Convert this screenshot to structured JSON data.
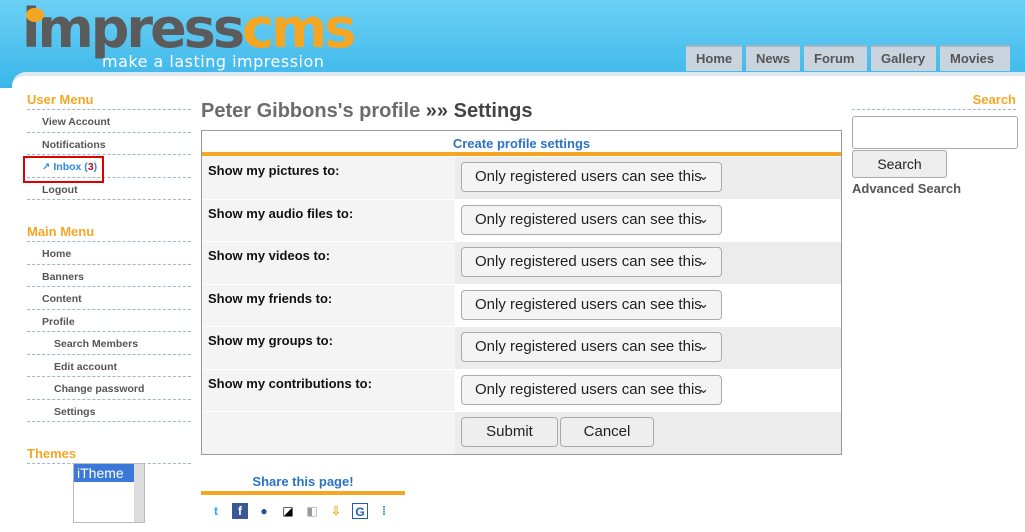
{
  "logo": {
    "part1": "impress",
    "part2": "cms",
    "tagline": "make a lasting impression"
  },
  "topnav": [
    "Home",
    "News",
    "Forum",
    "Gallery",
    "Movies"
  ],
  "user_menu": {
    "title": "User Menu",
    "items": [
      "View Account",
      "Notifications"
    ],
    "inbox_label": "Inbox (",
    "inbox_count": "3",
    "inbox_close": ")",
    "logout": "Logout"
  },
  "main_menu": {
    "title": "Main Menu",
    "items": [
      "Home",
      "Banners",
      "Content",
      "Profile"
    ],
    "subitems": [
      "Search Members",
      "Edit account",
      "Change password",
      "Settings"
    ]
  },
  "themes": {
    "title": "Themes",
    "selected": "iTheme"
  },
  "heading": {
    "crumb": "Peter Gibbons's profile",
    "sep": " »» ",
    "title": "Settings"
  },
  "form": {
    "header": "Create profile settings",
    "rows": [
      {
        "label": "Show my pictures to:",
        "value": "Only registered users can see this"
      },
      {
        "label": "Show my audio files to:",
        "value": "Only registered users can see this"
      },
      {
        "label": "Show my videos to:",
        "value": "Only registered users can see this"
      },
      {
        "label": "Show my friends to:",
        "value": "Only registered users can see this"
      },
      {
        "label": "Show my groups to:",
        "value": "Only registered users can see this"
      },
      {
        "label": "Show my contributions to:",
        "value": "Only registered users can see this"
      }
    ],
    "submit": "Submit",
    "cancel": "Cancel"
  },
  "share": {
    "title": "Share this page!"
  },
  "search": {
    "title": "Search",
    "button": "Search",
    "advanced": "Advanced Search",
    "value": ""
  },
  "colors": {
    "accent": "#f5a623",
    "link": "#2a73c5",
    "header": "#3ab6ea"
  }
}
